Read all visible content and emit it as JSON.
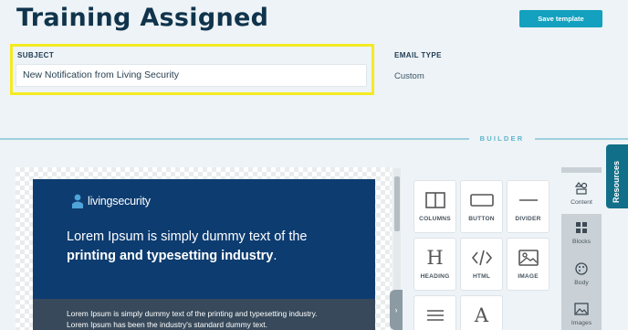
{
  "header": {
    "title": "Training Assigned",
    "save_label": "Save template"
  },
  "subject": {
    "label": "SUBJECT",
    "value": "New Notification from Living Security"
  },
  "email_type": {
    "label": "EMAIL TYPE",
    "value": "Custom"
  },
  "builder": {
    "label": "BUILDER"
  },
  "preview": {
    "logo_prefix": "living",
    "logo_suffix": "security",
    "hero_pre": "Lorem Ipsum is simply dummy text of the ",
    "hero_bold": "printing and typesetting industry",
    "hero_post": ".",
    "body_line1": "Lorem Ipsum is simply dummy text of the printing and typesetting industry.",
    "body_line2": "Lorem Ipsum has been the industry's standard dummy text."
  },
  "tools": [
    {
      "label": "COLUMNS",
      "icon": "columns-icon"
    },
    {
      "label": "BUTTON",
      "icon": "button-icon"
    },
    {
      "label": "DIVIDER",
      "icon": "divider-icon"
    },
    {
      "label": "HEADING",
      "icon": "heading-icon"
    },
    {
      "label": "HTML",
      "icon": "code-icon"
    },
    {
      "label": "IMAGE",
      "icon": "image-icon"
    },
    {
      "label": "",
      "icon": "text-icon"
    },
    {
      "label": "",
      "icon": "font-icon"
    }
  ],
  "side_tabs": [
    {
      "label": "Content",
      "icon": "shapes-icon",
      "active": true
    },
    {
      "label": "Blocks",
      "icon": "grid-icon"
    },
    {
      "label": "Body",
      "icon": "palette-icon"
    },
    {
      "label": "Images",
      "icon": "images-icon"
    }
  ],
  "resources": {
    "label": "Resources"
  },
  "colors": {
    "accent": "#14a0bf",
    "highlight": "#f4ea22",
    "email_header": "#0d3c70",
    "resources_tab": "#116f89"
  }
}
